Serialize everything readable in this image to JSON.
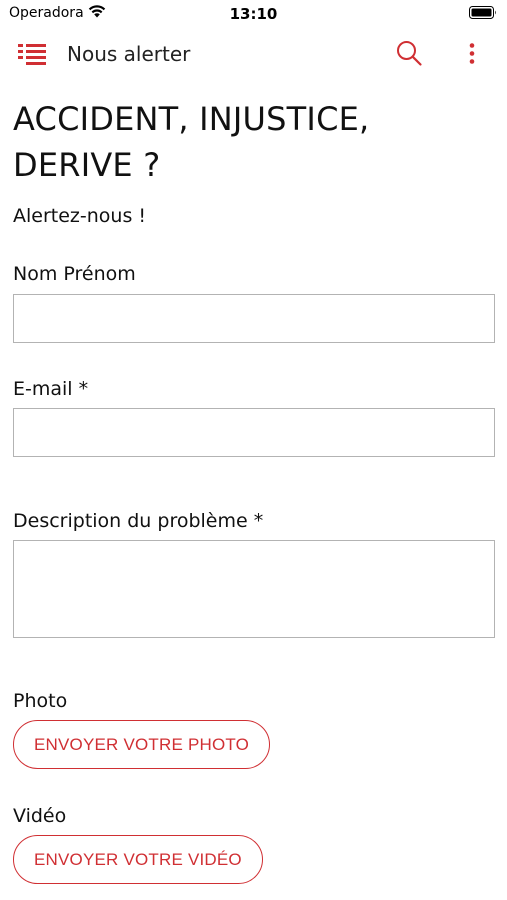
{
  "status_bar": {
    "carrier": "Operadora",
    "time": "13:10"
  },
  "app_bar": {
    "title": "Nous alerter"
  },
  "colors": {
    "accent": "#d02f33",
    "input_border": "#b3b3b3"
  },
  "icons": [
    "wifi-icon",
    "battery-icon",
    "menu-icon",
    "search-icon",
    "more-vertical-icon"
  ],
  "form": {
    "headline": "ACCIDENT,  INJUSTICE, DERIVE ?",
    "subtitle": "Alertez-nous !",
    "name_label": "Nom Prénom",
    "name_value": "",
    "email_label": "E-mail *",
    "email_value": "",
    "description_label": "Description du problème *",
    "description_value": "",
    "photo_label": "Photo",
    "photo_button": "ENVOYER VOTRE PHOTO",
    "video_label": "Vidéo",
    "video_button": "ENVOYER VOTRE VIDÉO"
  }
}
